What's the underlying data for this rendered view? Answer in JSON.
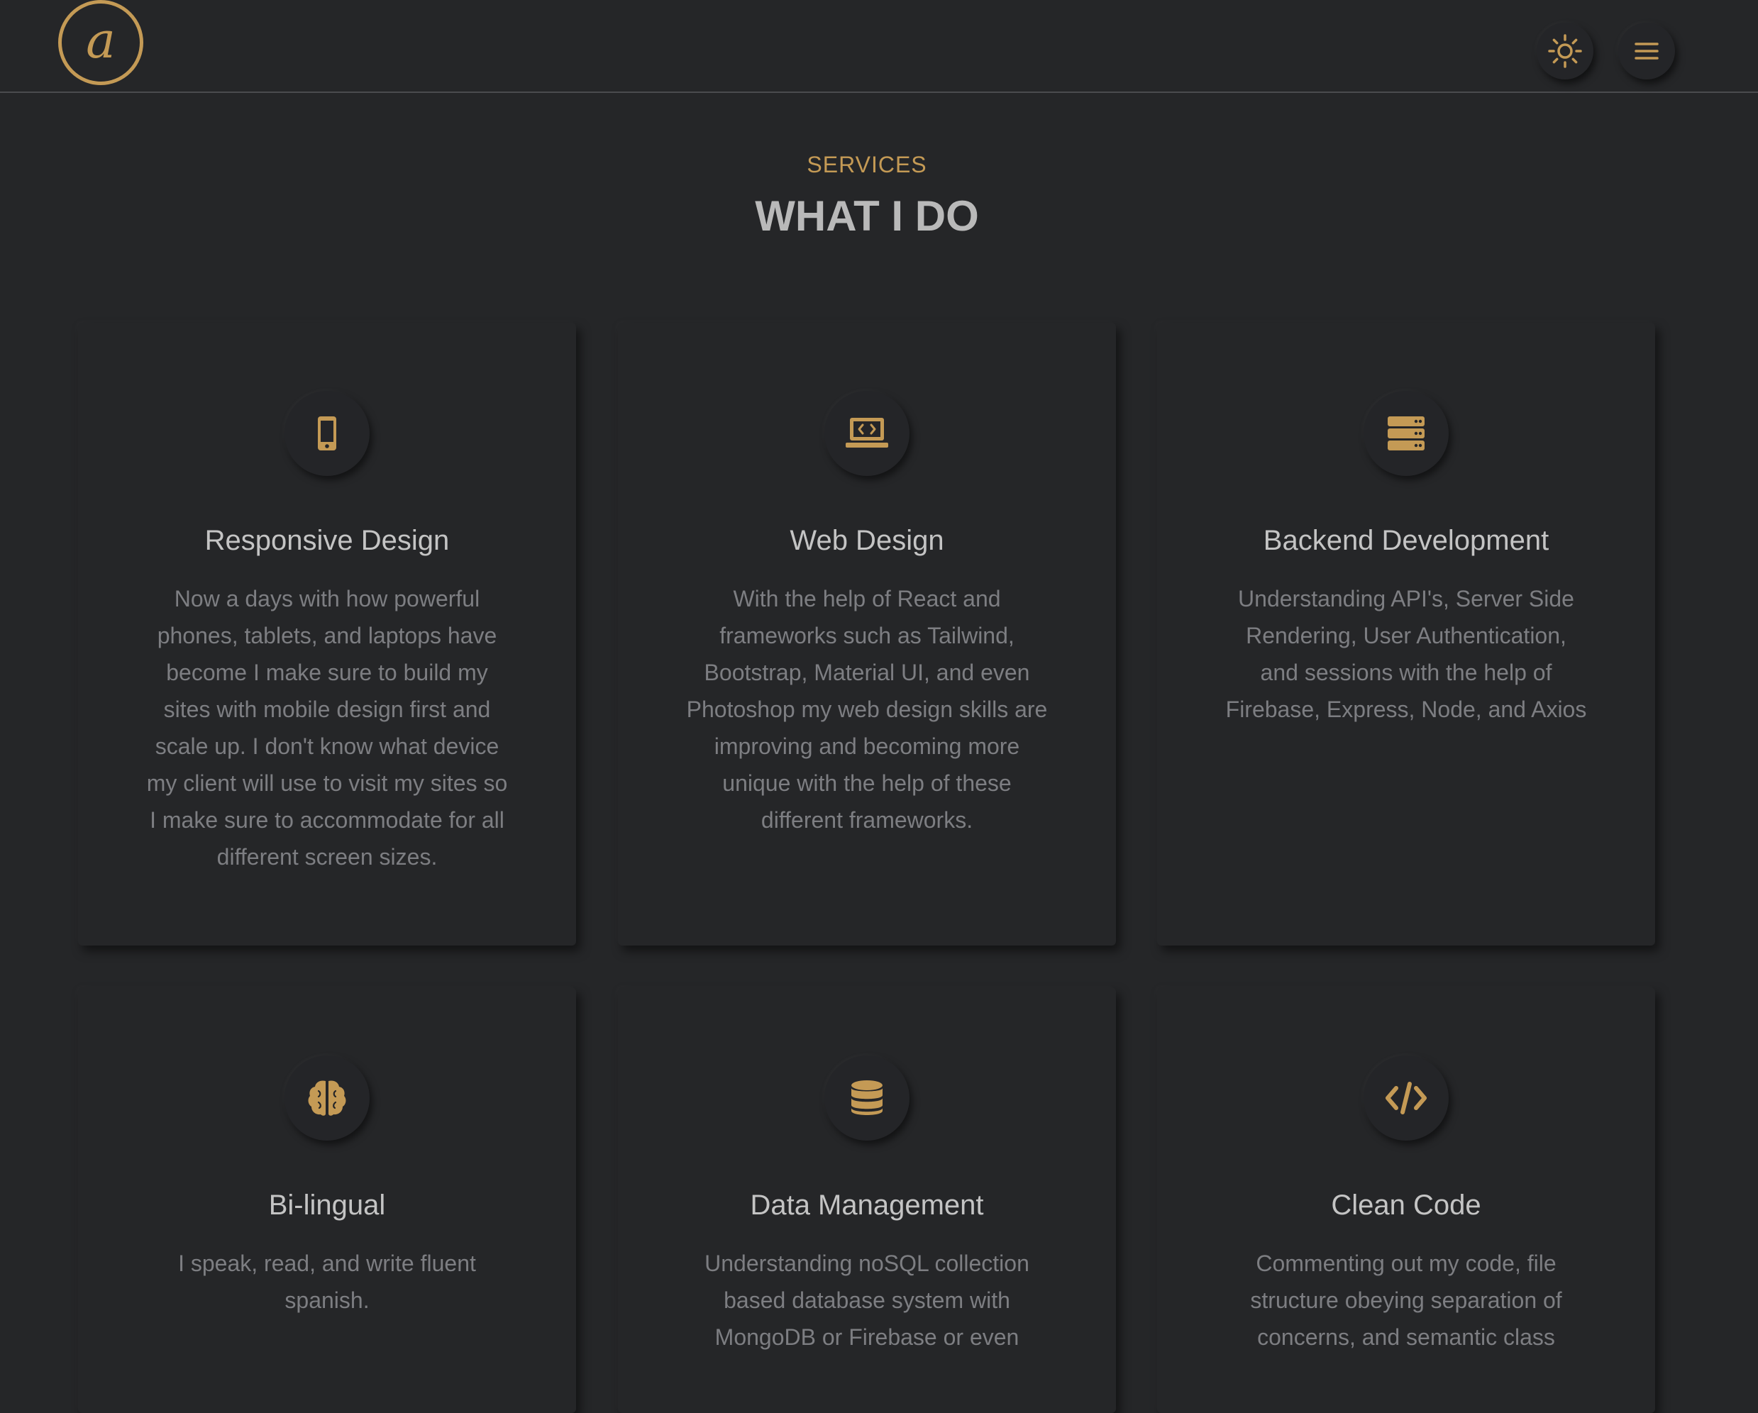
{
  "header": {
    "logo_letter": "a",
    "theme_toggle_icon": "sun-icon",
    "menu_icon": "hamburger-menu-icon"
  },
  "section": {
    "subtitle": "SERVICES",
    "title": "WHAT I DO"
  },
  "colors": {
    "accent": "#c49a55",
    "background": "#252628",
    "title_text": "#c4c4c4",
    "body_text": "#7d7e82"
  },
  "services": [
    {
      "icon": "mobile-phone-icon",
      "title": "Responsive Design",
      "text": "Now a days with how powerful phones, tablets, and laptops have become I make sure to build my sites with mobile design first and scale up. I don't know what device my client will use to visit my sites so I make sure to accommodate for all different screen sizes."
    },
    {
      "icon": "laptop-code-icon",
      "title": "Web Design",
      "text": "With the help of React and frameworks such as Tailwind, Bootstrap, Material UI, and even Photoshop my web design skills are improving and becoming more unique with the help of these different frameworks."
    },
    {
      "icon": "server-icon",
      "title": "Backend Development",
      "text": "Understanding API's, Server Side Rendering, User Authentication, and sessions with the help of Firebase, Express, Node, and Axios"
    },
    {
      "icon": "brain-icon",
      "title": "Bi-lingual",
      "text": "I speak, read, and write fluent spanish."
    },
    {
      "icon": "database-icon",
      "title": "Data Management",
      "text": "Understanding noSQL collection based database system with MongoDB or Firebase or even"
    },
    {
      "icon": "code-icon",
      "title": "Clean Code",
      "text": "Commenting out my code, file structure obeying separation of concerns, and semantic class"
    }
  ]
}
